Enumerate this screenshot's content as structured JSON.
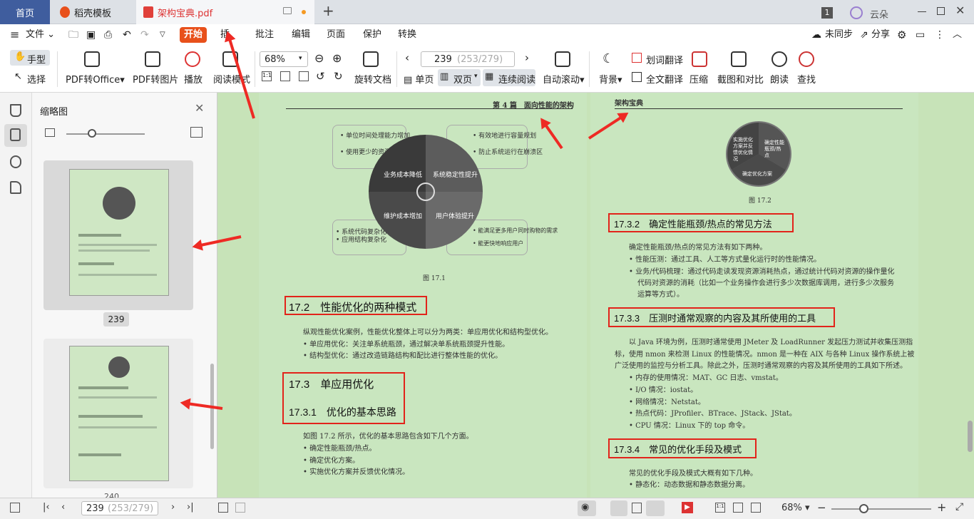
{
  "tabs": {
    "home": "首页",
    "template": "稻壳模板",
    "document": "架构宝典.pdf",
    "page_count_badge": "1",
    "user": "云朵"
  },
  "menu": {
    "file": "文件",
    "start": "开始",
    "insert": "插",
    "annotate": "批注",
    "edit": "编辑",
    "page": "页面",
    "protect": "保护",
    "convert": "转换",
    "unsynced": "未同步",
    "share": "分享"
  },
  "toolbar": {
    "hand": "手型",
    "select": "选择",
    "pdf_to_office": "PDF转Office",
    "pdf_to_image": "PDF转图片",
    "play": "播放",
    "read_mode": "阅读模式",
    "zoom": "68%",
    "rotate_doc": "旋转文档",
    "page_input": "239",
    "page_total": "(253/279)",
    "single": "单页",
    "double": "双页",
    "continuous": "连续阅读",
    "auto_scroll": "自动滚动",
    "background": "背景",
    "word_translate": "划词翻译",
    "full_translate": "全文翻译",
    "compress": "压缩",
    "screenshot_compare": "截图和对比",
    "read_aloud": "朗读",
    "find": "查找"
  },
  "thumbnail_panel": {
    "title": "缩略图",
    "page_label_1": "239",
    "page_label_2": "240"
  },
  "left_page": {
    "header": "第 4 篇　面向性能的架构",
    "pie": {
      "q1": "业务成本降低",
      "q2": "系统稳定性提升",
      "q3": "维护成本增加",
      "q4": "用户体验提升",
      "box_tl": [
        "单位时间处理能力增加",
        "使用更少的资源提供服务"
      ],
      "box_tr": [
        "有效地进行容量规划",
        "防止系统运行在崩溃区"
      ],
      "box_bl": [
        "系统代码复杂化",
        "应用结构复杂化"
      ],
      "box_br": [
        "能满足更多用户同时购物的需求",
        "能更快地响应用户"
      ]
    },
    "fig_caption": "图 17.1",
    "h_17_2": "17.2　性能优化的两种模式",
    "p1": "纵观性能优化案例，性能优化整体上可以分为两类：单应用优化和结构型优化。",
    "b1": "单应用优化：关注单系统瓶颈，通过解决单系统瓶颈提升性能。",
    "b2": "结构型优化：通过改造链路结构和配比进行整体性能的优化。",
    "h_17_3": "17.3　单应用优化",
    "h_17_3_1": "17.3.1　优化的基本思路",
    "p2": "如图 17.2 所示，优化的基本思路包含如下几个方面。",
    "b3": "确定性能瓶颈/热点。",
    "b4": "确定优化方案。",
    "b5": "实施优化方案并反馈优化情况。"
  },
  "right_page": {
    "header": "架构宝典",
    "mini_pie": {
      "s1": "实施优化方案并反馈优化情况",
      "s2": "确定性能瓶颈/热点",
      "s3": "确定优化方案"
    },
    "fig_caption": "图 17.2",
    "h_17_3_2": "17.3.2　确定性能瓶颈/热点的常见方法",
    "p1": "确定性能瓶颈/热点的常见方法有如下两种。",
    "b1": "性能压测：通过工具、人工等方式量化运行时的性能情况。",
    "b2a": "业务/代码梳理：通过代码走读发现资源消耗热点，通过统计代码对资源的操作量化",
    "b2b": "代码对资源的消耗（比如一个业务操作会进行多少次数据库调用，进行多少次服务",
    "b2c": "运算等方式）。",
    "h_17_3_3": "17.3.3　压测时通常观察的内容及其所使用的工具",
    "p2a": "以 Java 环境为例，压测时通常使用 JMeter 及 LoadRunner 发起压力测试并收集压测指",
    "p2b": "标，使用 nmon 来检测 Linux 的性能情况。nmon 是一种在 AIX 与各种 Linux 操作系统上被",
    "p2c": "广泛使用的监控与分析工具。除此之外，压测时通常观察的内容及其所使用的工具如下所述。",
    "b3": "内存的使用情况：MAT、GC 日志、vmstat。",
    "b4": "I/O 情况：iostat。",
    "b5": "网络情况：Netstat。",
    "b6": "热点代码：JProfiler、BTrace、JStack、JStat。",
    "b7": "CPU 情况：Linux 下的 top 命令。",
    "h_17_3_4": "17.3.4　常见的优化手段及模式",
    "p3": "常见的优化手段及模式大概有如下几种。",
    "b8": "静态化：动态数据和静态数据分离。"
  },
  "statusbar": {
    "page_input": "239",
    "page_total": "(253/279)",
    "zoom": "68%"
  },
  "colors": {
    "accent": "#e8501b",
    "home_tab": "#3f5d9e",
    "page_bg": "#c9e6bf",
    "highlight_box": "#e2231a"
  }
}
